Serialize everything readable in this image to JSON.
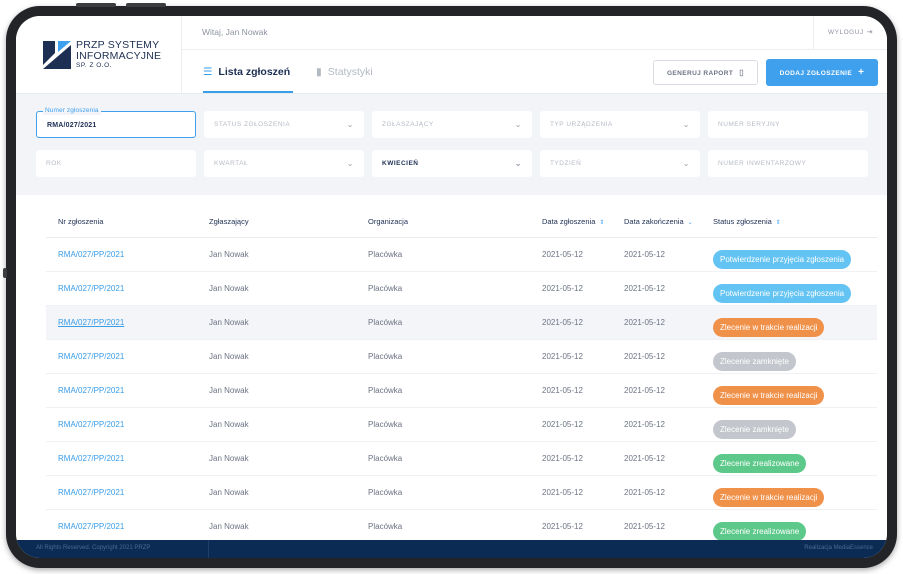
{
  "brand": {
    "line1": "PRZP SYSTEMY",
    "line2": "INFORMACYJNE",
    "line3": "SP. Z O.O."
  },
  "header": {
    "welcome": "Witaj, Jan Nowak",
    "logout": "WYLOGUJ",
    "tabs": [
      {
        "label": "Lista zgłoszeń",
        "active": true
      },
      {
        "label": "Statystyki",
        "active": false
      }
    ],
    "report_button": "GENERUJ RAPORT",
    "add_button": "DODAJ ZGŁOSZENIE"
  },
  "filters": {
    "number": {
      "label": "Numer zgłoszenia",
      "value": "RMA/027/2021"
    },
    "status": "STATUS ZGŁOSZENIA",
    "reporter": "ZGŁASZAJĄCY",
    "device_type": "TYP URZĄDZENIA",
    "serial": "NUMER SERYJNY",
    "year": "ROK",
    "quarter": "KWARTAŁ",
    "month": "KWIECIEŃ",
    "week": "TYDZIEŃ",
    "inventory": "NUMER INWENTARZOWY"
  },
  "table": {
    "headers": {
      "number": "Nr zgłoszenia",
      "reporter": "Zgłaszający",
      "organization": "Organizacja",
      "date_reported": "Data zgłoszenia",
      "date_closed": "Data zakończenia",
      "status": "Status zgłoszenia"
    },
    "rows": [
      {
        "number": "RMA/027/PP/2021",
        "reporter": "Jan Nowak",
        "organization": "Placówka",
        "date_reported": "2021-05-12",
        "date_closed": "2021-05-12",
        "status": "Potwierdzenie przyjęcia zgłoszenia"
      },
      {
        "number": "RMA/027/PP/2021",
        "reporter": "Jan Nowak",
        "organization": "Placówka",
        "date_reported": "2021-05-12",
        "date_closed": "2021-05-12",
        "status": "Potwierdzenie przyjęcia zgłoszenia"
      },
      {
        "number": "RMA/027/PP/2021",
        "reporter": "Jan Nowak",
        "organization": "Placówka",
        "date_reported": "2021-05-12",
        "date_closed": "2021-05-12",
        "status": "Zlecenie w trakcie realizacji"
      },
      {
        "number": "RMA/027/PP/2021",
        "reporter": "Jan Nowak",
        "organization": "Placówka",
        "date_reported": "2021-05-12",
        "date_closed": "2021-05-12",
        "status": "Zlecenie zamknięte"
      },
      {
        "number": "RMA/027/PP/2021",
        "reporter": "Jan Nowak",
        "organization": "Placówka",
        "date_reported": "2021-05-12",
        "date_closed": "2021-05-12",
        "status": "Zlecenie w trakcie realizacji"
      },
      {
        "number": "RMA/027/PP/2021",
        "reporter": "Jan Nowak",
        "organization": "Placówka",
        "date_reported": "2021-05-12",
        "date_closed": "2021-05-12",
        "status": "Zlecenie zamknięte"
      },
      {
        "number": "RMA/027/PP/2021",
        "reporter": "Jan Nowak",
        "organization": "Placówka",
        "date_reported": "2021-05-12",
        "date_closed": "2021-05-12",
        "status": "Zlecenie zrealizowane"
      },
      {
        "number": "RMA/027/PP/2021",
        "reporter": "Jan Nowak",
        "organization": "Placówka",
        "date_reported": "2021-05-12",
        "date_closed": "2021-05-12",
        "status": "Zlecenie w trakcie realizacji"
      },
      {
        "number": "RMA/027/PP/2021",
        "reporter": "Jan Nowak",
        "organization": "Placówka",
        "date_reported": "2021-05-12",
        "date_closed": "2021-05-12",
        "status": "Zlecenie zrealizowane"
      }
    ]
  },
  "status_colors": {
    "Potwierdzenie przyjęcia zgłoszenia": "#63c3f3",
    "Zlecenie w trakcie realizacji": "#f0914a",
    "Zlecenie zamknięte": "#c3c6cc",
    "Zlecenie zrealizowane": "#5cc98a"
  },
  "colors": {
    "accent": "#3fa0ee",
    "navy": "#1d2f53",
    "footer": "#0b2b55"
  },
  "footer": {
    "left": "All Rights Reserved. Copyright 2021 PRZP",
    "right": "Realizacja MediaEssence"
  }
}
